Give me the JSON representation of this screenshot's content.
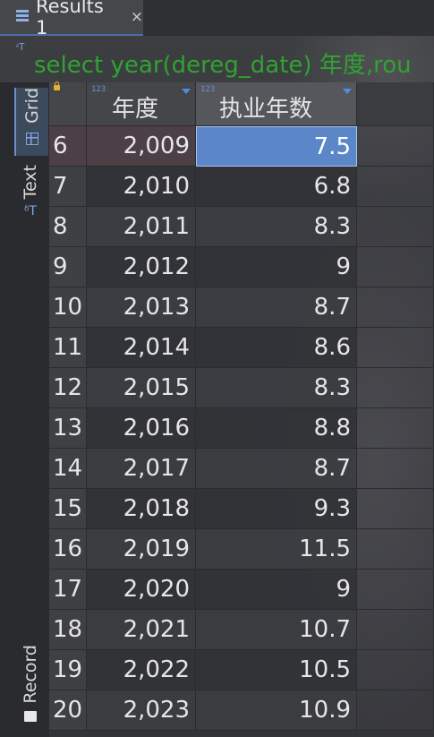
{
  "tab": {
    "title": "Results 1",
    "close": "×"
  },
  "query": {
    "icon": "ᵟT",
    "text": "select year(dereg_date) 年度,rou"
  },
  "side_tabs": {
    "grid": "Grid",
    "text": "Text",
    "record": "Record",
    "text_icon": "ᵟT"
  },
  "columns": {
    "col1": {
      "label": "年度",
      "type": "123"
    },
    "col2": {
      "label": "执业年数",
      "type": "123"
    }
  },
  "rows": [
    {
      "n": "6",
      "year": "2,009",
      "value": "7.5"
    },
    {
      "n": "7",
      "year": "2,010",
      "value": "6.8"
    },
    {
      "n": "8",
      "year": "2,011",
      "value": "8.3"
    },
    {
      "n": "9",
      "year": "2,012",
      "value": "9"
    },
    {
      "n": "10",
      "year": "2,013",
      "value": "8.7"
    },
    {
      "n": "11",
      "year": "2,014",
      "value": "8.6"
    },
    {
      "n": "12",
      "year": "2,015",
      "value": "8.3"
    },
    {
      "n": "13",
      "year": "2,016",
      "value": "8.8"
    },
    {
      "n": "14",
      "year": "2,017",
      "value": "8.7"
    },
    {
      "n": "15",
      "year": "2,018",
      "value": "9.3"
    },
    {
      "n": "16",
      "year": "2,019",
      "value": "11.5"
    },
    {
      "n": "17",
      "year": "2,020",
      "value": "9"
    },
    {
      "n": "18",
      "year": "2,021",
      "value": "10.7"
    },
    {
      "n": "19",
      "year": "2,022",
      "value": "10.5"
    },
    {
      "n": "20",
      "year": "2,023",
      "value": "10.9"
    }
  ],
  "colors": {
    "selection": "#5b87c8",
    "query_text": "#2fa32f",
    "tab_underline": "#4a6ea9"
  }
}
